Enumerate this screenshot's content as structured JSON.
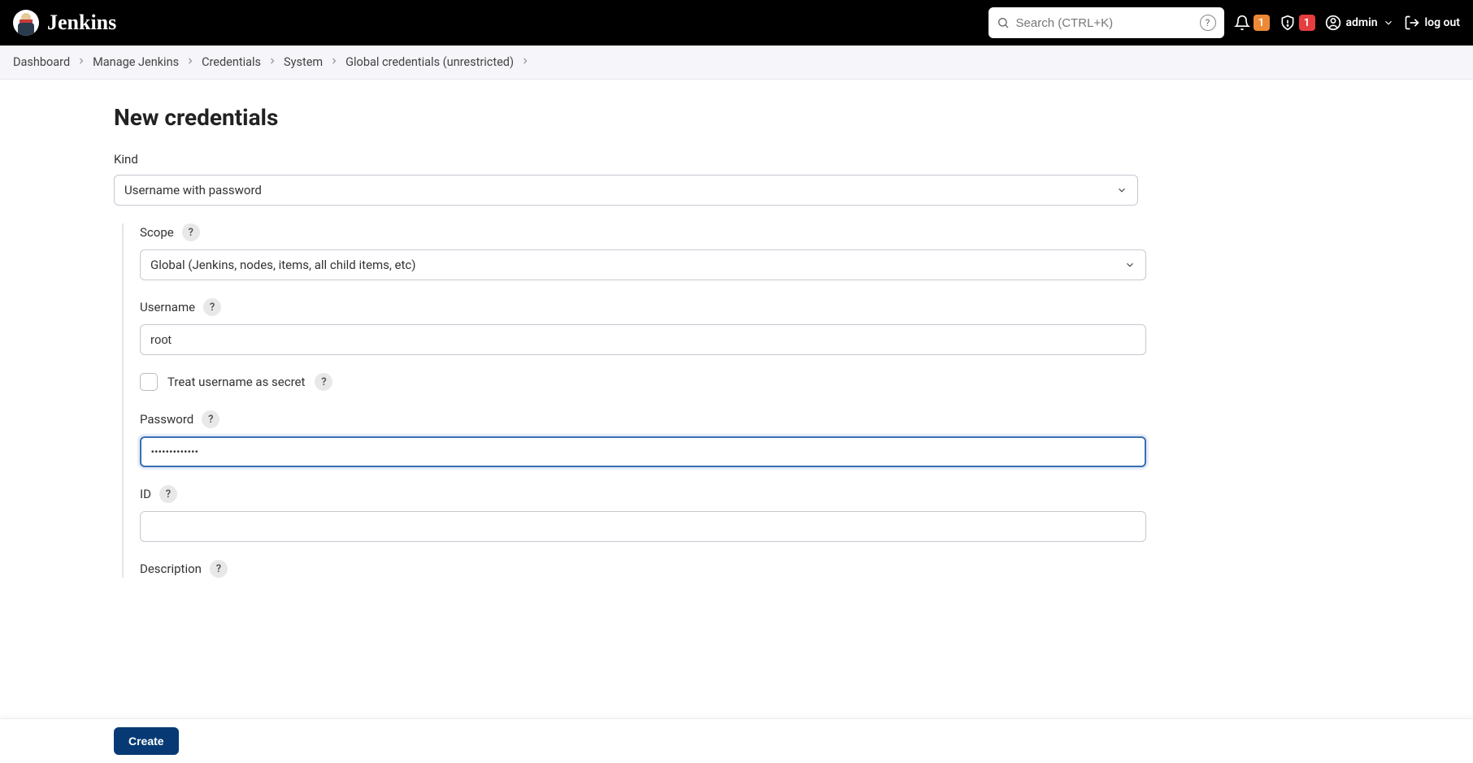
{
  "header": {
    "brand": "Jenkins",
    "search_placeholder": "Search (CTRL+K)",
    "notif_count": "1",
    "security_count": "1",
    "user": "admin",
    "logout": "log out"
  },
  "breadcrumbs": [
    "Dashboard",
    "Manage Jenkins",
    "Credentials",
    "System",
    "Global credentials (unrestricted)"
  ],
  "page": {
    "title": "New credentials",
    "kind_label": "Kind",
    "kind_value": "Username with password",
    "scope_label": "Scope",
    "scope_value": "Global (Jenkins, nodes, items, all child items, etc)",
    "username_label": "Username",
    "username_value": "root",
    "treat_secret_label": "Treat username as secret",
    "password_label": "Password",
    "password_value": "•••••••••••••",
    "id_label": "ID",
    "id_value": "",
    "description_label": "Description",
    "create_button": "Create"
  }
}
